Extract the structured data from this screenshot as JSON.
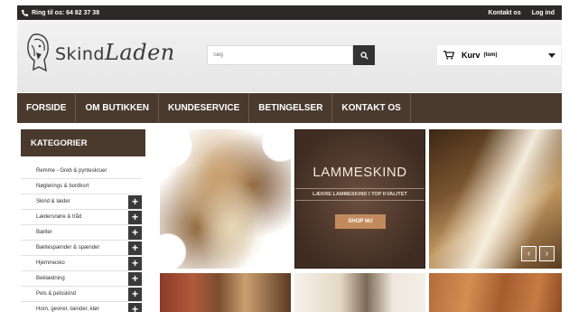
{
  "topbar": {
    "phone_text": "Ring til os: 64 82 37 38",
    "links": [
      "Kontakt os",
      "Log ind"
    ]
  },
  "logo": {
    "word1": "Skind",
    "word2": "Laden"
  },
  "search": {
    "placeholder": "Søg"
  },
  "cart": {
    "label": "Kurv",
    "status": "(tom)"
  },
  "nav": {
    "items": [
      "FORSIDE",
      "OM BUTIKKEN",
      "KUNDESERVICE",
      "BETINGELSER",
      "KONTAKT OS"
    ]
  },
  "sidebar": {
    "title": "KATEGORIER",
    "categories": [
      {
        "label": "Remme - Greb & pynteskruer",
        "expandable": false
      },
      {
        "label": "Nøglerings & bordkort",
        "expandable": false
      },
      {
        "label": "Skind & læder",
        "expandable": true
      },
      {
        "label": "Lædersnøre & tråd",
        "expandable": true
      },
      {
        "label": "Bælter",
        "expandable": true
      },
      {
        "label": "Bæltespænder & spænder",
        "expandable": true
      },
      {
        "label": "Hjemmesko",
        "expandable": true
      },
      {
        "label": "Beklædning",
        "expandable": true
      },
      {
        "label": "Pels & pelsskind",
        "expandable": true
      },
      {
        "label": "Horn, gevirer, tænder, klør",
        "expandable": true
      }
    ]
  },
  "banner": {
    "title": "LAMMESKIND",
    "subtitle": "LÆKRE LAMMESKIND I TOP KVALITET",
    "cta": "SHOP NU"
  },
  "carousel": {
    "prev": "‹",
    "next": "›"
  },
  "colors": {
    "brand_brown": "#4a3a2e",
    "topbar": "#2b2a29",
    "accent": "#c28a5c"
  }
}
